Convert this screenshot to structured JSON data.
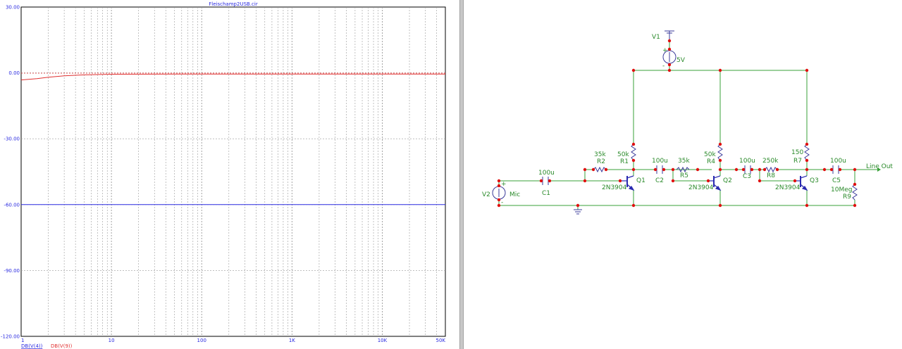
{
  "plot": {
    "title": "Fleischamp2USB.cir",
    "traces": [
      {
        "label": "DB(V(4))",
        "color": "#2a2ae0"
      },
      {
        "label": "DB(V(9))",
        "color": "#e03030"
      }
    ]
  },
  "chart_data": {
    "type": "line",
    "title": "Fleischamp2USB.cir",
    "xscale": "log",
    "xlim": [
      1,
      50000
    ],
    "ylim": [
      -120,
      30
    ],
    "grid": true,
    "x_tick_labels": [
      "1",
      "10",
      "100",
      "1K",
      "10K",
      "50K"
    ],
    "x_tick_values": [
      1,
      10,
      100,
      1000,
      10000,
      50000
    ],
    "y_tick_labels": [
      "30.00",
      "0.00",
      "-30.00",
      "-60.00",
      "-90.00",
      "-120.00"
    ],
    "y_tick_values": [
      30,
      0,
      -30,
      -60,
      -90,
      -120
    ],
    "series": [
      {
        "name": "DB(V(4))",
        "color": "#2a2ae0",
        "x": [
          1,
          50000
        ],
        "y": [
          -60,
          -60
        ]
      },
      {
        "name": "DB(V(9))",
        "color": "#e03030",
        "x": [
          1,
          1.5,
          2,
          3,
          5,
          10,
          100,
          1000,
          10000,
          50000
        ],
        "y": [
          -3.2,
          -2.6,
          -2.0,
          -1.3,
          -0.9,
          -0.6,
          -0.5,
          -0.5,
          -0.5,
          -0.5
        ]
      }
    ]
  },
  "schematic": {
    "labels": {
      "v1": "V1",
      "v1_value": "5V",
      "v2": "V2",
      "mic": "Mic",
      "c1_value": "100u",
      "c1": "C1",
      "r2_value": "35k",
      "r2": "R2",
      "r1_value": "50k",
      "r1": "R1",
      "q1": "Q1",
      "q1_model": "2N3904",
      "c2_value": "100u",
      "c2": "C2",
      "r5_value": "35k",
      "r5": "R5",
      "r4_value": "50k",
      "r4": "R4",
      "q2": "Q2",
      "q2_model": "2N3904",
      "c3_value": "100u",
      "c3": "C3",
      "r8_value": "250k",
      "r8": "R8",
      "r7_value": "150",
      "r7": "R7",
      "q3": "Q3",
      "q3_model": "2N3904",
      "c5_value": "100u",
      "c5": "C5",
      "r9_value": "10Meg",
      "r9": "R9",
      "line_out": "Line Out",
      "plus": "+",
      "minus": "-"
    }
  }
}
